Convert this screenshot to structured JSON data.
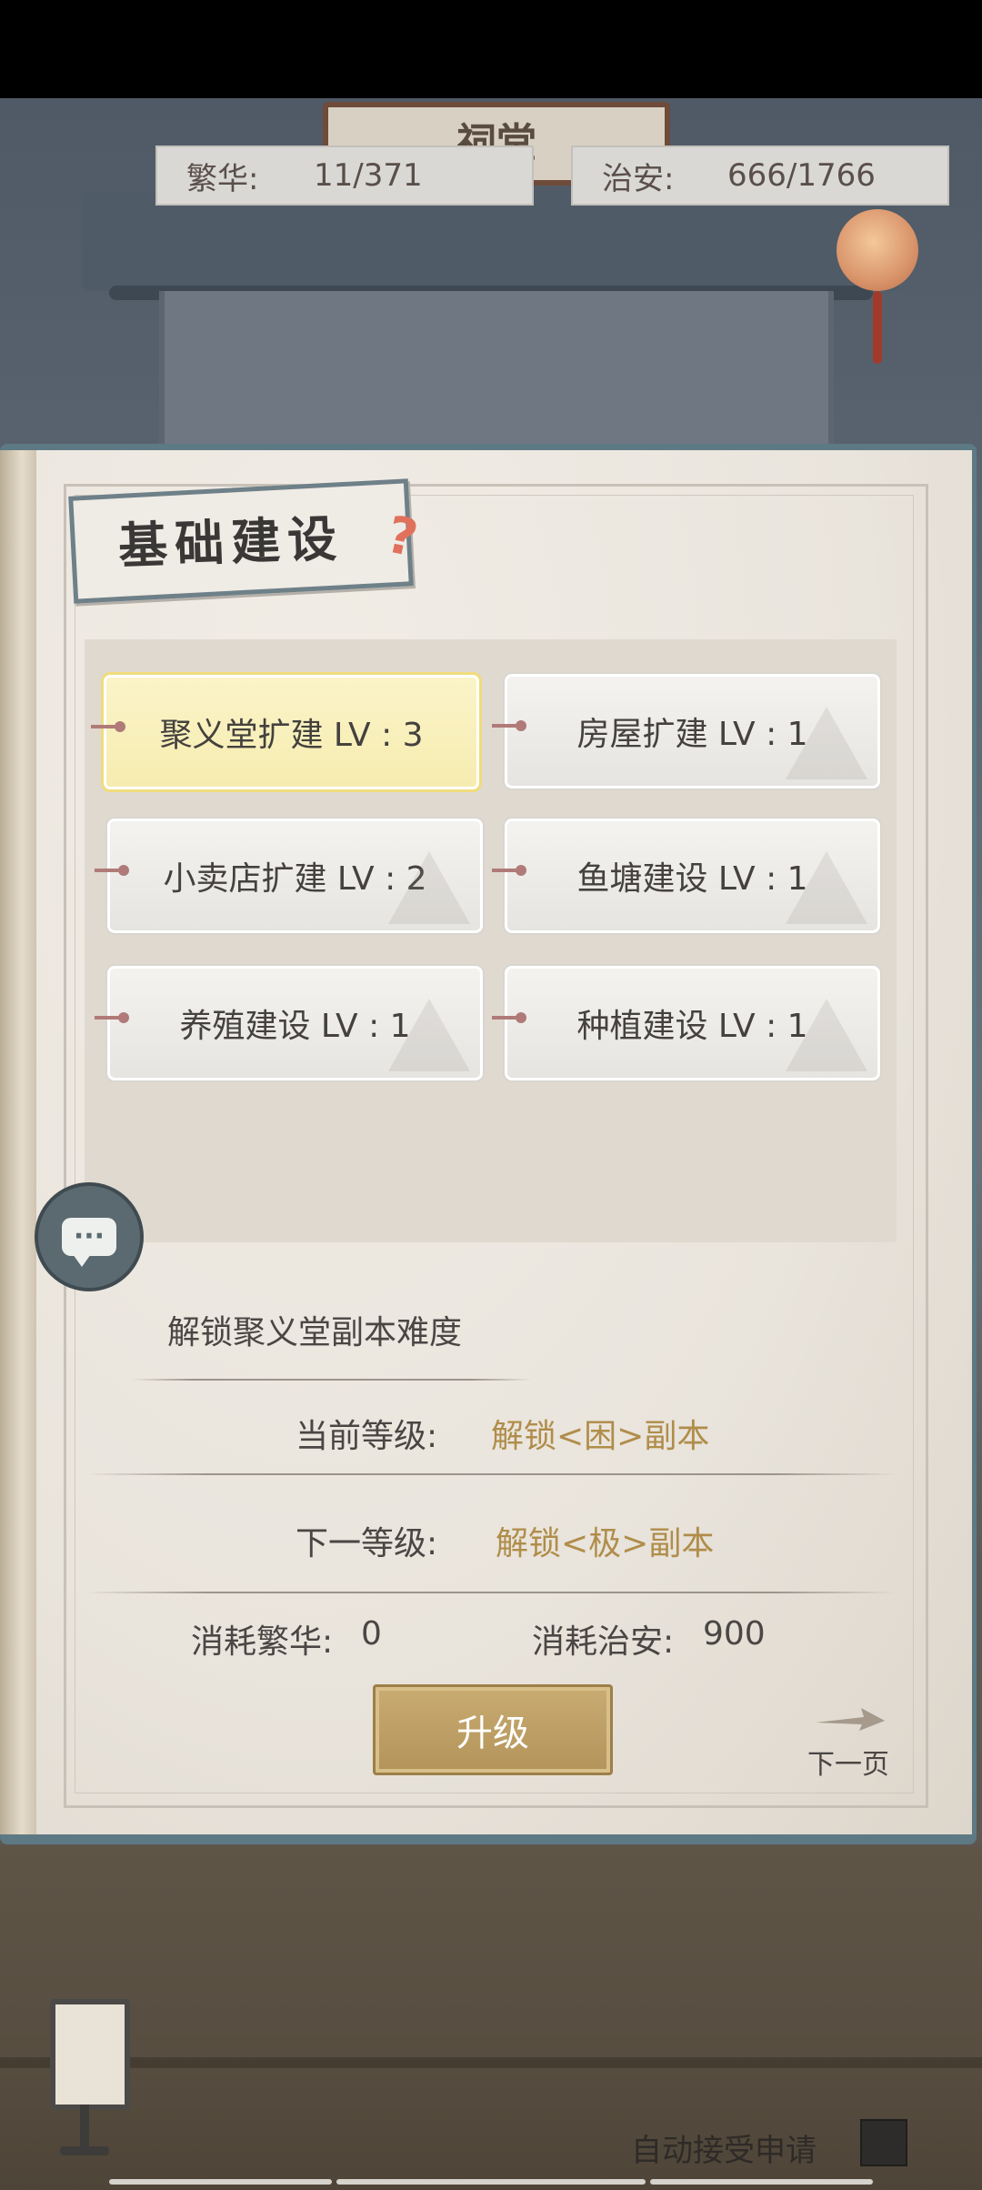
{
  "top_stats": {
    "prosperity_label": "繁华:",
    "prosperity_value": "11/371",
    "order_label": "治安:",
    "order_value": "666/1766"
  },
  "building_sign": "祠堂",
  "panel": {
    "title": "基础建设",
    "buildings": [
      {
        "label": "聚义堂扩建 LV : 3",
        "selected": true
      },
      {
        "label": "房屋扩建 LV : 1",
        "selected": false
      },
      {
        "label": "小卖店扩建 LV : 2",
        "selected": false
      },
      {
        "label": "鱼塘建设 LV : 1",
        "selected": false
      },
      {
        "label": "养殖建设 LV : 1",
        "selected": false
      },
      {
        "label": "种植建设 LV : 1",
        "selected": false
      }
    ]
  },
  "detail": {
    "description": "解锁聚义堂副本难度",
    "current_level_label": "当前等级:",
    "current_level_value": "解锁<困>副本",
    "next_level_label": "下一等级:",
    "next_level_value": "解锁<极>副本",
    "cost_prosperity_label": "消耗繁华:",
    "cost_prosperity_value": "0",
    "cost_order_label": "消耗治安:",
    "cost_order_value": "900"
  },
  "buttons": {
    "upgrade": "升级",
    "next_page": "下一页"
  },
  "footer": {
    "auto_accept_label": "自动接受申请",
    "auto_accept_checked": false
  },
  "colors": {
    "accent_gold": "#b08d4a",
    "selected_tile": "#f6ecb0",
    "frame_teal": "#5d7a84"
  },
  "icons": {
    "help": "question-mark-icon",
    "chat": "chat-bubble-icon",
    "next": "arrow-right-icon"
  }
}
